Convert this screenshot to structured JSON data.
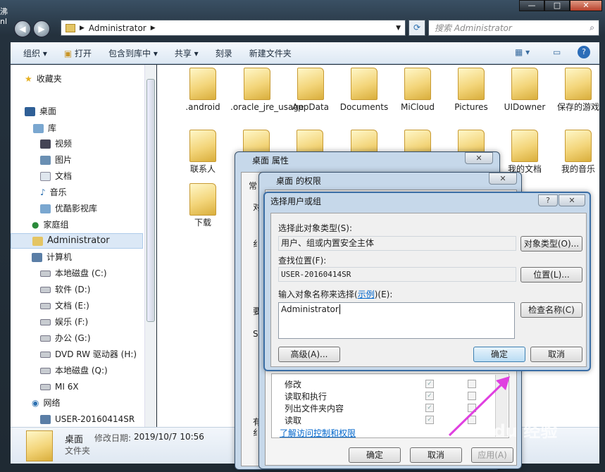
{
  "window": {
    "left_edge_text": "沸 nl",
    "min": "—",
    "max": "□",
    "close": "✕"
  },
  "address": {
    "path": "Administrator",
    "search_placeholder": "搜索 Administrator"
  },
  "toolbar": {
    "organize": "组织 ▾",
    "open": "打开",
    "include": "包含到库中 ▾",
    "share": "共享 ▾",
    "burn": "刻录",
    "new_folder": "新建文件夹"
  },
  "nav": {
    "favorites": "收藏夹",
    "desktop": "桌面",
    "libraries": "库",
    "videos": "视频",
    "pictures": "图片",
    "docs": "文档",
    "music": "音乐",
    "youku": "优酷影视库",
    "homegroup": "家庭组",
    "admin": "Administrator",
    "computer": "计算机",
    "drives": [
      "本地磁盘 (C:)",
      "软件 (D:)",
      "文档 (E:)",
      "娱乐 (F:)",
      "办公 (G:)",
      "DVD RW 驱动器 (H:)",
      "本地磁盘 (Q:)",
      "MI 6X"
    ],
    "network": "网络",
    "host": "USER-20160414SR"
  },
  "files": [
    ".android",
    ".oracle_jre_usage",
    "AppData",
    "Documents",
    "MiCloud",
    "Pictures",
    "UIDowner",
    "保存的游戏",
    "联系人",
    "",
    "",
    "",
    "",
    "",
    "我的文档",
    "我的音乐",
    "下载"
  ],
  "details": {
    "name": "桌面",
    "modified_label": "修改日期:",
    "modified": "2019/10/7 10:56",
    "type": "文件夹"
  },
  "props": {
    "title": "桌面 属性",
    "close": "✕",
    "tab_frag": "常",
    "frag1": "对",
    "frag2": "纟",
    "frag3": "要",
    "frag4": "S",
    "frag5": "有",
    "frag6": "纟"
  },
  "perm": {
    "title": "桌面 的权限",
    "close": "✕",
    "rows": [
      {
        "name": "修改",
        "allow": true,
        "deny": false
      },
      {
        "name": "读取和执行",
        "allow": true,
        "deny": false
      },
      {
        "name": "列出文件夹内容",
        "allow": true,
        "deny": false
      },
      {
        "name": "读取",
        "allow": true,
        "deny": false
      }
    ],
    "link": "了解访问控制和权限",
    "ok": "确定",
    "cancel": "取消",
    "apply": "应用(A)"
  },
  "select": {
    "title": "选择用户或组",
    "help": "?",
    "close": "✕",
    "type_label": "选择此对象类型(S):",
    "type_value": "用户、组或内置安全主体",
    "type_btn": "对象类型(O)...",
    "loc_label": "查找位置(F):",
    "loc_value": "USER-20160414SR",
    "loc_btn": "位置(L)...",
    "name_label_a": "输入对象名称来选择(",
    "name_label_link": "示例",
    "name_label_b": ")(E):",
    "name_value": "Administrator",
    "check_btn": "检查名称(C)",
    "adv_btn": "高级(A)...",
    "ok": "确定",
    "cancel": "取消"
  },
  "watermark": "Baidu 经验",
  "colors": {
    "accent": "#3c7fb1",
    "arrow": "#e040e0",
    "link": "#0066cc"
  }
}
